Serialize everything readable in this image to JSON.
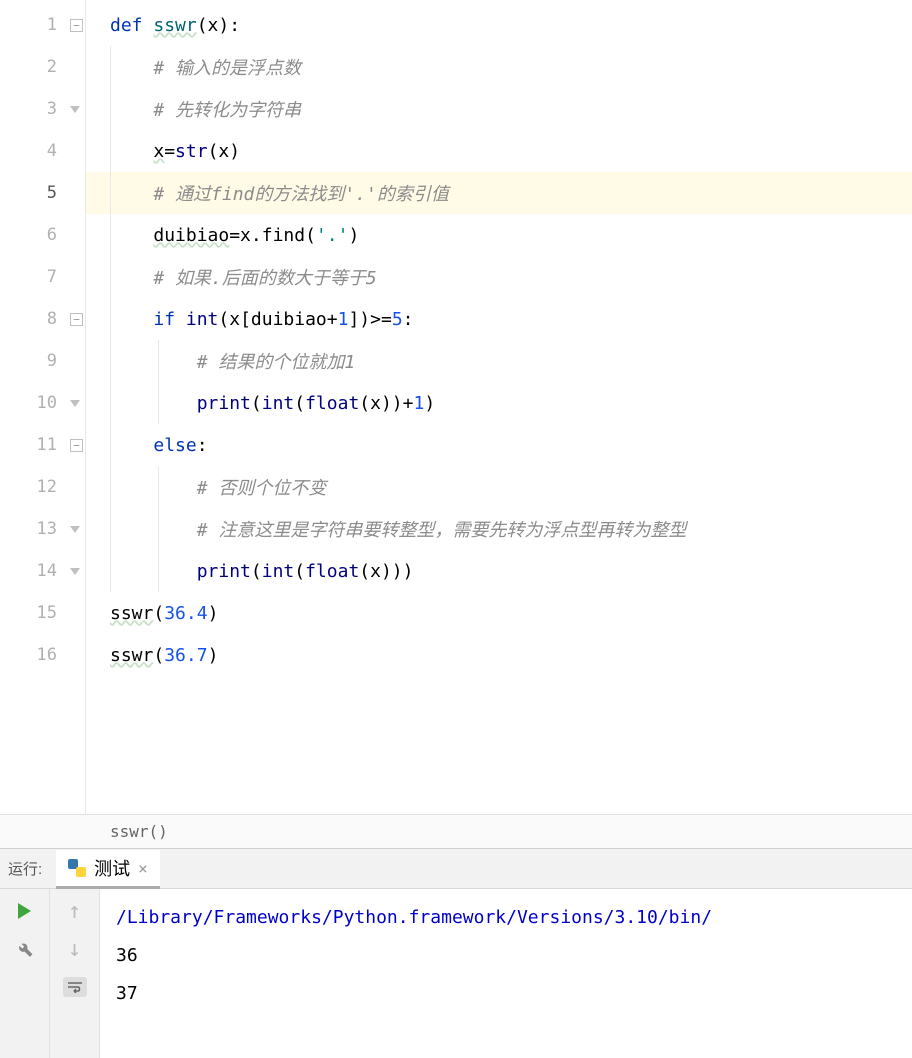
{
  "lines": [
    {
      "n": 1,
      "fold": "minus"
    },
    {
      "n": 2
    },
    {
      "n": 3,
      "fold": "end"
    },
    {
      "n": 4
    },
    {
      "n": 5,
      "current": true,
      "highlight": true
    },
    {
      "n": 6
    },
    {
      "n": 7
    },
    {
      "n": 8,
      "fold": "minus"
    },
    {
      "n": 9
    },
    {
      "n": 10,
      "fold": "end"
    },
    {
      "n": 11,
      "fold": "minus"
    },
    {
      "n": 12
    },
    {
      "n": 13,
      "fold": "end"
    },
    {
      "n": 14,
      "fold": "end"
    },
    {
      "n": 15
    },
    {
      "n": 16
    }
  ],
  "code": {
    "l1_def": "def ",
    "l1_fn": "sswr",
    "l1_rest": "(x):",
    "l2_cm": "# 输入的是浮点数",
    "l3_cm": "# 先转化为字符串",
    "l4_var": "x",
    "l4_eq": "=",
    "l4_str": "str",
    "l4_rest": "(x)",
    "l5_cm": "# 通过find的方法找到'.'的索引值",
    "l6_var": "duibiao",
    "l6_eq": "=x.find(",
    "l6_str": "'.'",
    "l6_rest": ")",
    "l7_cm": "# 如果.后面的数大于等于5",
    "l8_if": "if ",
    "l8_int": "int",
    "l8_p1": "(x[duibiao+",
    "l8_n1": "1",
    "l8_p2": "])>=",
    "l8_n5": "5",
    "l8_colon": ":",
    "l9_cm": "# 结果的个位就加1",
    "l10_print": "print",
    "l10_p1": "(",
    "l10_int": "int",
    "l10_p2": "(",
    "l10_float": "float",
    "l10_p3": "(x))+",
    "l10_n1": "1",
    "l10_p4": ")",
    "l11_else": "else",
    "l11_colon": ":",
    "l12_cm": "# 否则个位不变",
    "l13_cm": "# 注意这里是字符串要转整型，需要先转为浮点型再转为整型",
    "l14_print": "print",
    "l14_p1": "(",
    "l14_int": "int",
    "l14_p2": "(",
    "l14_float": "float",
    "l14_p3": "(x)))",
    "l15_fn": "sswr",
    "l15_p1": "(",
    "l15_n": "36.4",
    "l15_p2": ")",
    "l16_fn": "sswr",
    "l16_p1": "(",
    "l16_n": "36.7",
    "l16_p2": ")"
  },
  "breadcrumb": "sswr()",
  "run": {
    "label": "运行:",
    "tab_name": "测试",
    "close": "×"
  },
  "console": {
    "path": "/Library/Frameworks/Python.framework/Versions/3.10/bin/",
    "out1": "36",
    "out2": "37"
  }
}
